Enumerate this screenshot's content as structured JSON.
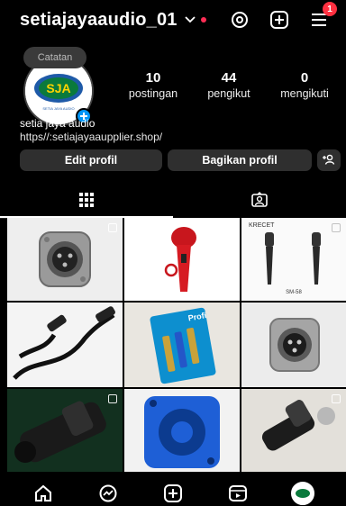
{
  "header": {
    "username": "setiajayaaudio_01",
    "notification_count": "1",
    "icons": [
      "chevron-down-icon",
      "threads-icon",
      "add-post-icon",
      "menu-icon"
    ]
  },
  "note": {
    "label": "Catatan"
  },
  "profile": {
    "avatar_text": "SJA",
    "avatar_subtext": "SETIA JAYA AUDIO",
    "display_name": "setia jaya audio",
    "link": "https//:setiajayaaupplier.shop/",
    "stats": [
      {
        "value": "10",
        "label": "postingan"
      },
      {
        "value": "44",
        "label": "pengikut"
      },
      {
        "value": "0",
        "label": "mengikuti"
      }
    ]
  },
  "buttons": {
    "edit": "Edit profil",
    "share": "Bagikan profil"
  },
  "tabs": [
    "grid-icon",
    "tagged-icon"
  ],
  "posts": [
    {
      "subject": "xlr-panel-connector-female",
      "multi": true
    },
    {
      "subject": "red-microphone",
      "multi": true
    },
    {
      "subject": "two-microphones",
      "multi": true,
      "caption": "SM-58"
    },
    {
      "subject": "xlr-cable",
      "multi": false
    },
    {
      "subject": "profi-connectors-pack",
      "multi": false,
      "caption": "Profi"
    },
    {
      "subject": "xlr-panel-connector-male",
      "multi": false
    },
    {
      "subject": "speakon-connector",
      "multi": true
    },
    {
      "subject": "blue-speakon-panel",
      "multi": false
    },
    {
      "subject": "speakon-connector-2",
      "multi": true
    }
  ],
  "colors": {
    "accent": "#0095f6",
    "badge": "#ff3040",
    "button_bg": "#2f2f2f"
  },
  "bottom_nav": [
    "home-icon",
    "messenger-icon",
    "create-icon",
    "reels-icon",
    "profile-avatar"
  ]
}
